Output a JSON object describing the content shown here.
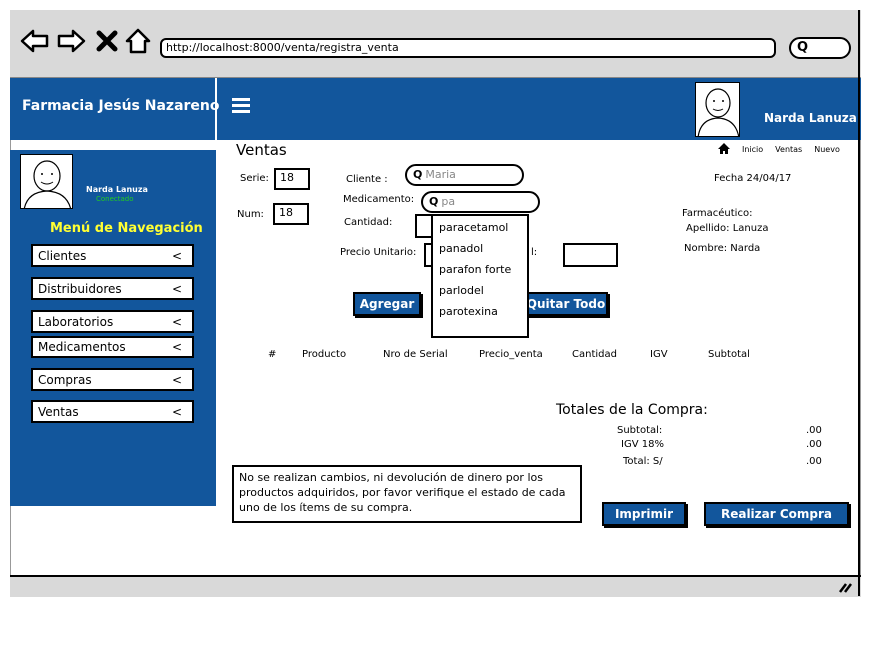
{
  "browser": {
    "url": "http://localhost:8000/venta/registra_venta",
    "search_icon_glyph": "Q"
  },
  "header": {
    "app_name": "Farmacia Jesús Nazareno",
    "user_name": "Narda Lanuza",
    "color": "#12569c"
  },
  "sidebar": {
    "user_name": "Narda Lanuza",
    "status": "Conectado",
    "status_color": "#22cc22",
    "menu_title": "Menú de Navegación",
    "items": [
      {
        "label": "Clientes",
        "arrow": "<"
      },
      {
        "label": "Distribuidores",
        "arrow": "<"
      },
      {
        "label": "Laboratorios",
        "arrow": "<"
      },
      {
        "label": "Medicamentos",
        "arrow": "<"
      },
      {
        "label": "Compras",
        "arrow": "<"
      },
      {
        "label": "Ventas",
        "arrow": "<"
      }
    ]
  },
  "breadcrumb": {
    "home_icon": "home-icon",
    "items": [
      "Inicio",
      "Ventas",
      "Nuevo"
    ]
  },
  "form": {
    "title": "Ventas",
    "serie_label": "Serie:",
    "serie_value": "18",
    "num_label": "Num:",
    "num_value": "18",
    "cliente_label": "Cliente :",
    "cliente_placeholder": "Maria",
    "medicamento_label": "Medicamento:",
    "medicamento_value": "pa",
    "cantidad_label": "Cantidad:",
    "precio_label": "Precio Unitario:",
    "total_label_fragment": "l:",
    "fecha": "Fecha 24/04/17",
    "farmaceutico_label": "Farmacéutico:",
    "apellido": "Apellido: Lanuza",
    "nombre": "Nombre:  Narda",
    "search_glyph": "Q"
  },
  "dropdown": {
    "options": [
      "paracetamol",
      "panadol",
      "parafon forte",
      "parlodel",
      "parotexina"
    ]
  },
  "buttons": {
    "agregar": "Agregar",
    "quitar_todo": "Quitar Todo",
    "imprimir": "Imprimir",
    "realizar_compra": "Realizar Compra"
  },
  "table": {
    "headers": [
      "#",
      "Producto",
      "Nro de Serial",
      "Precio_venta",
      "Cantidad",
      "IGV",
      "Subtotal"
    ]
  },
  "totals": {
    "title": "Totales de la Compra:",
    "rows": [
      {
        "label": "Subtotal:",
        "value": ".00"
      },
      {
        "label": "IGV 18%",
        "value": ".00"
      },
      {
        "label": "Total: S/",
        "value": ".00"
      }
    ]
  },
  "notice": "No se realizan cambios, ni devolución de dinero por los productos adquiridos, por favor verifique el estado de cada uno de los ítems de su compra."
}
